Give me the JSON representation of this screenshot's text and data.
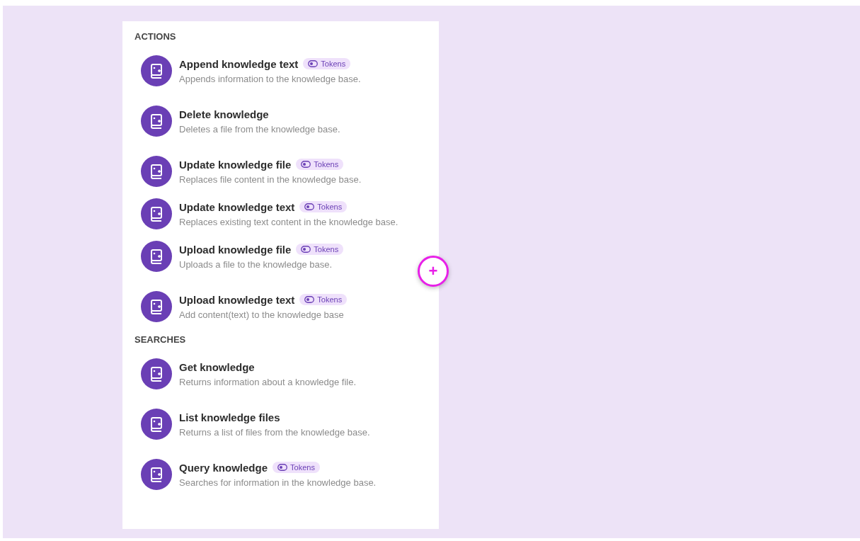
{
  "sections": [
    {
      "title": "ACTIONS",
      "items": [
        {
          "name": "Append knowledge text",
          "badge": "Tokens",
          "description": "Appends information to the knowledge base."
        },
        {
          "name": "Delete knowledge",
          "description": "Deletes a file from the knowledge base."
        },
        {
          "name": "Update knowledge file",
          "badge": "Tokens",
          "description": "Replaces file content in the knowledge base."
        },
        {
          "name": "Update knowledge text",
          "badge": "Tokens",
          "description": "Replaces existing text content in the knowledge base."
        },
        {
          "name": "Upload knowledge file",
          "badge": "Tokens",
          "description": "Uploads a file to the knowledge base."
        },
        {
          "name": "Upload knowledge text",
          "badge": "Tokens",
          "description": "Add content(text) to the knowledge base"
        }
      ]
    },
    {
      "title": "SEARCHES",
      "items": [
        {
          "name": "Get knowledge",
          "description": "Returns information about a knowledge file."
        },
        {
          "name": "List knowledge files",
          "description": "Returns a list of files from the knowledge base."
        },
        {
          "name": "Query knowledge",
          "badge": "Tokens",
          "description": "Searches for information in the knowledge base."
        }
      ]
    }
  ],
  "add_button": {
    "label": "+"
  }
}
